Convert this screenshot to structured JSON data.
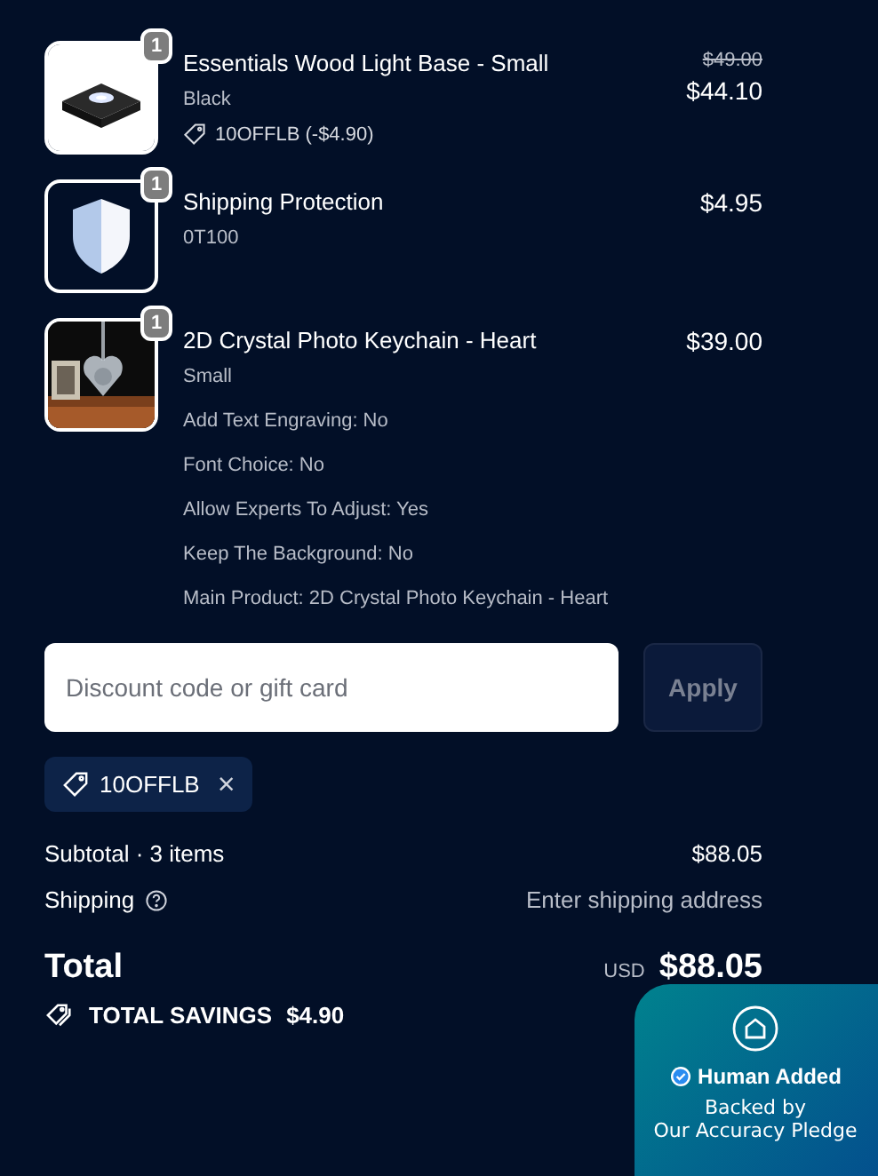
{
  "items": [
    {
      "kind": "light-base",
      "quantity": "1",
      "title": "Essentials Wood Light Base - Small",
      "details": [
        "Black"
      ],
      "discount": "10OFFLB (-$4.90)",
      "original_price": "$49.00",
      "price": "$44.10"
    },
    {
      "kind": "shield",
      "quantity": "1",
      "title": "Shipping Protection",
      "details": [
        "0T100"
      ],
      "price": "$4.95"
    },
    {
      "kind": "keychain",
      "quantity": "1",
      "title": "2D Crystal Photo Keychain - Heart",
      "details": [
        "Small",
        "Add Text Engraving: No",
        "Font Choice: No",
        "Allow Experts To Adjust: Yes",
        "Keep The Background: No",
        "Main Product: 2D Crystal Photo Keychain - Heart"
      ],
      "price": "$39.00"
    }
  ],
  "discount_field": {
    "placeholder": "Discount code or gift card",
    "button": "Apply",
    "disabled": true
  },
  "applied_codes": [
    {
      "code": "10OFFLB",
      "remove": "×"
    }
  ],
  "subtotal": {
    "label": "Subtotal · 3 items",
    "value": "$88.05"
  },
  "shipping": {
    "label": "Shipping",
    "value": "Enter shipping address"
  },
  "total": {
    "label": "Total",
    "currency": "USD",
    "value": "$88.05"
  },
  "savings": {
    "label": "TOTAL SAVINGS",
    "value": "$4.90"
  },
  "badge": {
    "title": "Human Added",
    "subtitle": "Backed by",
    "subtitle2": "Our Accuracy Pledge"
  }
}
